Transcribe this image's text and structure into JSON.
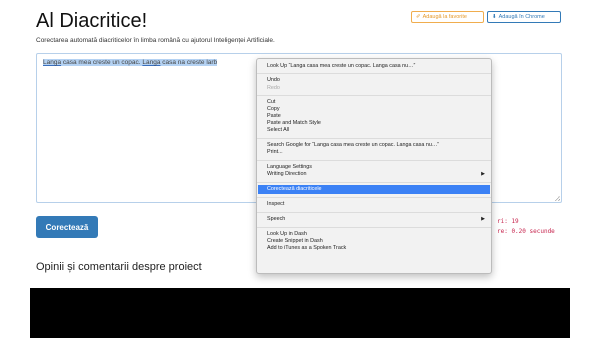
{
  "header": {
    "title": "Al Diacritice!",
    "subtitle": "Corectarea automată diacriticelor în limba română cu ajutorul Inteligenței Artificiale.",
    "fav_icon": "pencil-icon",
    "fav_label": "Adaugă la favorite",
    "chrome_icon": "download-icon",
    "chrome_label": "Adaugă în Chrome",
    "accent_color": "#337ab7",
    "fav_color": "#f0ad4e"
  },
  "editor": {
    "text_parts": [
      "Langa",
      " casa mea creste un copac. ",
      "Langa",
      " casa na creste larb"
    ]
  },
  "actions": {
    "correct_label": "Corectează"
  },
  "stats": {
    "line1": "ri: 19",
    "line2": "re: 0.20 secunde"
  },
  "comments": {
    "heading": "Opinii și comentarii despre proiect"
  },
  "context_menu": {
    "items": [
      {
        "label": "Look Up “Langa casa mea creste un copac. Langa casa nu…”"
      },
      {
        "label": "Undo"
      },
      {
        "label": "Redo",
        "disabled": true
      },
      {
        "label": "Cut"
      },
      {
        "label": "Copy"
      },
      {
        "label": "Paste"
      },
      {
        "label": "Paste and Match Style"
      },
      {
        "label": "Select All"
      },
      {
        "label": "Search Google for “Langa casa mea creste un copac. Langa casa nu…”"
      },
      {
        "label": "Print..."
      },
      {
        "label": "Language Settings"
      },
      {
        "label": "Writing Direction",
        "submenu": true
      },
      {
        "label": "Corectează diacriticele",
        "highlighted": true
      },
      {
        "label": "Inspect"
      },
      {
        "label": "Speech",
        "submenu": true
      },
      {
        "label": "Look Up in Dash"
      },
      {
        "label": "Create Snippet in Dash"
      },
      {
        "label": "Add to iTunes as a Spoken Track"
      }
    ],
    "highlight_color": "#3b81f5"
  }
}
